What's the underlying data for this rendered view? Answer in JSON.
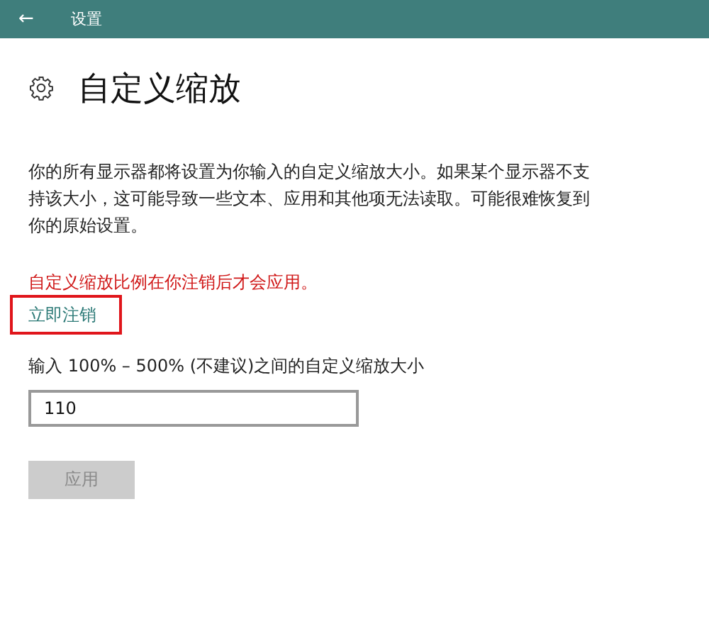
{
  "window": {
    "back": "←",
    "title": "设置"
  },
  "page": {
    "title": "自定义缩放"
  },
  "description": "你的所有显示器都将设置为你输入的自定义缩放大小。如果某个显示器不支持该大小，这可能导致一些文本、应用和其他项无法读取。可能很难恢复到你的原始设置。",
  "warning": "自定义缩放比例在你注销后才会应用。",
  "link": {
    "label": "立即注销",
    "highlighted": true
  },
  "field": {
    "label": "输入 100% – 500% (不建议)之间的自定义缩放大小",
    "value": "110"
  },
  "apply_button": {
    "label": "应用",
    "disabled": true
  }
}
